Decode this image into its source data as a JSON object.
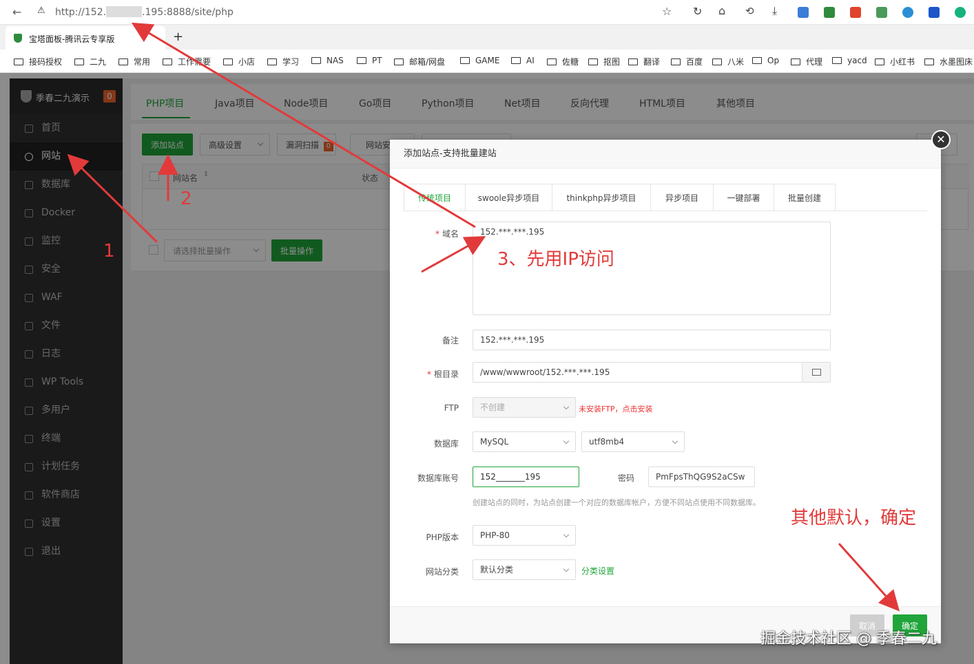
{
  "browser": {
    "url_prefix": "http://152.",
    "url_suffix": ".195:8888/site/php",
    "tab_title": "宝塔面板-腾讯云专享版",
    "new_tab": "+",
    "bookmarks": [
      "接码授权",
      "二九",
      "常用",
      "工作需要",
      "小店",
      "学习",
      "NAS",
      "PT",
      "邮箱/网盘",
      "GAME",
      "AI",
      "佐糖",
      "抠图",
      "翻译",
      "百度",
      "八米",
      "Op",
      "代理",
      "yacd",
      "小红书",
      "水墨图床"
    ]
  },
  "sidebar": {
    "brand": "季春二九演示",
    "badge": "0",
    "items": [
      "首页",
      "网站",
      "数据库",
      "Docker",
      "监控",
      "安全",
      "WAF",
      "文件",
      "日志",
      "WP Tools",
      "多用户",
      "终端",
      "计划任务",
      "软件商店",
      "设置",
      "退出"
    ]
  },
  "project_tabs": [
    "PHP项目",
    "Java项目",
    "Node项目",
    "Go项目",
    "Python项目",
    "Net项目",
    "反向代理",
    "HTML项目",
    "其他项目"
  ],
  "toolbar": {
    "add_site": "添加站点",
    "advanced": "高级设置",
    "vuln_scan": "漏洞扫描",
    "vuln_badge": "0",
    "site_security": "网站安全"
  },
  "table": {
    "col_name": "网站名",
    "col_status": "状态",
    "batch_select_placeholder": "请选择批量操作",
    "batch_button": "批量操作"
  },
  "dialog": {
    "title": "添加站点-支持批量建站",
    "tabs": [
      "传统项目",
      "swoole异步项目",
      "thinkphp异步项目",
      "异步项目",
      "一键部署",
      "批量创建"
    ],
    "domain_label": "域名",
    "domain_value": "152.***.***.195",
    "remark_label": "备注",
    "remark_value": "152.***.***.195",
    "root_label": "根目录",
    "root_value": "/www/wwwroot/152.***.***.195",
    "ftp_label": "FTP",
    "ftp_value": "不创建",
    "ftp_warning": "未安装FTP，点击安装",
    "db_label": "数据库",
    "db_type": "MySQL",
    "db_charset": "utf8mb4",
    "db_user_label": "数据库账号",
    "db_user_value": "152_______195",
    "db_pass_label": "密码",
    "db_pass_value": "PmFpsThQG9S2aCSw",
    "db_hint": "创建站点的同时，为站点创建一个对应的数据库帐户，方便不同站点使用不同数据库。",
    "php_label": "PHP版本",
    "php_value": "PHP-80",
    "category_label": "网站分类",
    "category_value": "默认分类",
    "category_link": "分类设置",
    "cancel": "取消",
    "confirm": "确定"
  },
  "annotations": {
    "num1": "1",
    "num2": "2",
    "step3": "3、先用IP访问",
    "others": "其他默认，确定",
    "watermark": "掘金技术社区 @ 季春二九"
  },
  "colors": {
    "accent": "#20a53a",
    "annotation": "#e23a3a",
    "sidebar": "#303030"
  }
}
